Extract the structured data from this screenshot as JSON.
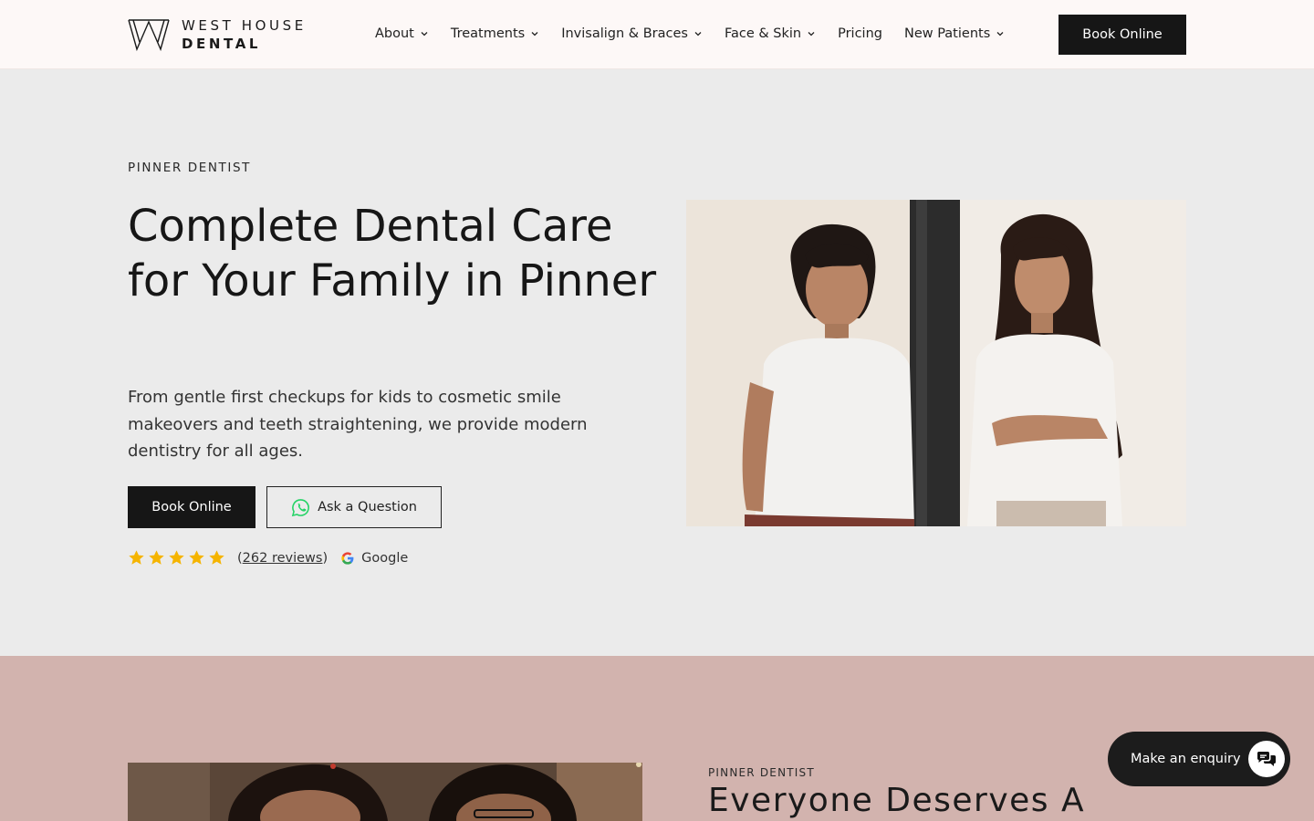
{
  "header": {
    "logo": {
      "line1": "WEST HOUSE",
      "line2": "DENTAL"
    },
    "nav": [
      {
        "label": "About",
        "has_dropdown": true
      },
      {
        "label": "Treatments",
        "has_dropdown": true
      },
      {
        "label": "Invisalign & Braces",
        "has_dropdown": true
      },
      {
        "label": "Face & Skin",
        "has_dropdown": true
      },
      {
        "label": "Pricing",
        "has_dropdown": false
      },
      {
        "label": "New Patients",
        "has_dropdown": true
      }
    ],
    "book_label": "Book Online"
  },
  "hero": {
    "eyebrow": "PINNER DENTIST",
    "title": "Complete Dental Care for Your Family in Pinner",
    "description": "From gentle first checkups for kids to cosmetic smile makeovers and teeth straightening, we provide modern dentistry for all ages.",
    "book_label": "Book Online",
    "ask_label": "Ask a Question",
    "ask_icon": "whatsapp-icon",
    "rating": {
      "stars": 5,
      "reviews_prefix": "(",
      "reviews_link": "262 reviews",
      "reviews_suffix": ")",
      "source": "Google"
    }
  },
  "section2": {
    "eyebrow": "PINNER DENTIST",
    "title": "Everyone Deserves A"
  },
  "enquiry": {
    "label": "Make an enquiry",
    "icon": "chat-bubbles-icon"
  },
  "colors": {
    "header_bg": "#fdf8f7",
    "hero_bg": "#ebebeb",
    "section2_bg": "#d2b3ae",
    "button_dark": "#161616",
    "star": "#f5b400",
    "whatsapp": "#25d366"
  }
}
